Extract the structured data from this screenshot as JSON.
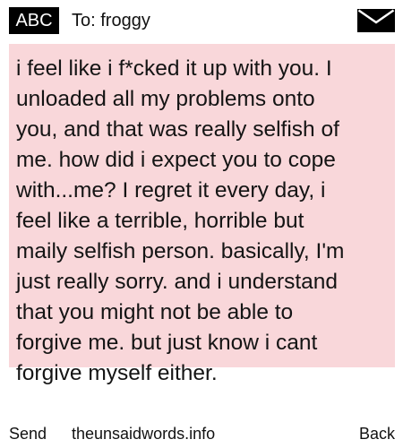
{
  "header": {
    "mode_badge": "ABC",
    "recipient": "To: froggy",
    "mail_icon": "envelope-icon"
  },
  "message": {
    "body": "i feel like i f*cked it up with you. I\nunloaded all my problems onto\nyou, and that was really selfish of\nme. how did i expect you to cope\nwith...me? I regret it every day, i\nfeel like a terrible, horrible but\nmaily selfish person. basically, I'm\njust really sorry. and i understand\nthat you might not be able to\nforgive me. but just know i cant\nforgive myself either."
  },
  "footer": {
    "send_label": "Send",
    "site_label": "theunsaidwords.info",
    "back_label": "Back"
  },
  "colors": {
    "background": "#ffffff",
    "message_fill": "#f9d7da",
    "badge_fill": "#000000",
    "badge_text": "#ffffff"
  }
}
